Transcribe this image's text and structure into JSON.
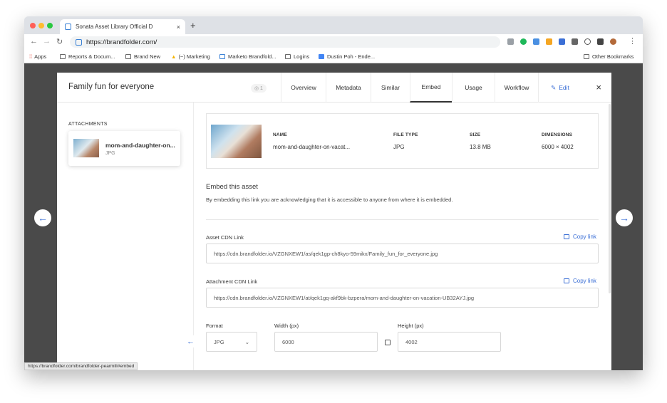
{
  "browser": {
    "tab_title": "Sonata Asset Library Official D",
    "tab_close": "×",
    "new_tab": "+",
    "url": "https://brandfolder.com/",
    "bookmarks": [
      {
        "label": "Apps",
        "icon": "apps-grid-icon"
      },
      {
        "label": "Reports & Docum...",
        "icon": "folder-icon"
      },
      {
        "label": "Brand New",
        "icon": "bookmark-icon"
      },
      {
        "label": "(~) Marketing",
        "icon": "drive-icon"
      },
      {
        "label": "Marketo Brandfold...",
        "icon": "brandfolder-icon"
      },
      {
        "label": "Logins",
        "icon": "folder-icon"
      },
      {
        "label": "Dustin Poh - Ende...",
        "icon": "doc-icon"
      },
      {
        "label": "Other Bookmarks",
        "icon": "folder-icon"
      }
    ],
    "status_url": "https://brandfolder.com/brandfolder-pearmill#embed"
  },
  "modal": {
    "title": "Family fun for everyone",
    "views_badge": "◎ 1",
    "tabs": [
      "Overview",
      "Metadata",
      "Similar",
      "Embed",
      "Usage",
      "Workflow"
    ],
    "active_tab": "Embed",
    "edit_label": "Edit",
    "close": "×"
  },
  "sidebar": {
    "title": "ATTACHMENTS",
    "attachment": {
      "name": "mom-and-daughter-on...",
      "type": "JPG"
    }
  },
  "info": {
    "headers": {
      "name": "NAME",
      "filetype": "FILE TYPE",
      "size": "SIZE",
      "dimensions": "DIMENSIONS"
    },
    "values": {
      "name": "mom-and-daughter-on-vacat...",
      "filetype": "JPG",
      "size": "13.8 MB",
      "dimensions": "6000 × 4002"
    }
  },
  "embed": {
    "title": "Embed this asset",
    "description": "By embedding this link you are acknowledging that it is accessible to anyone from where it is embedded.",
    "asset_label": "Asset CDN Link",
    "asset_link": "https://cdn.brandfolder.io/VZGNXEW1/as/qek1gp-ch8kyo-59mikx/Family_fun_for_everyone.jpg",
    "attachment_label": "Attachment CDN Link",
    "attachment_link": "https://cdn.brandfolder.io/VZGNXEW1/at/qek1gq-akf9bk-bzpera/mom-and-daughter-on-vacation-UB32AYJ.jpg",
    "copy_label": "Copy link",
    "format_label": "Format",
    "format_value": "JPG",
    "width_label": "Width (px)",
    "width_value": "6000",
    "height_label": "Height (px)",
    "height_value": "4002"
  },
  "colors": {
    "accent": "#3b6fd6",
    "backdrop": "#4a4a4a"
  }
}
